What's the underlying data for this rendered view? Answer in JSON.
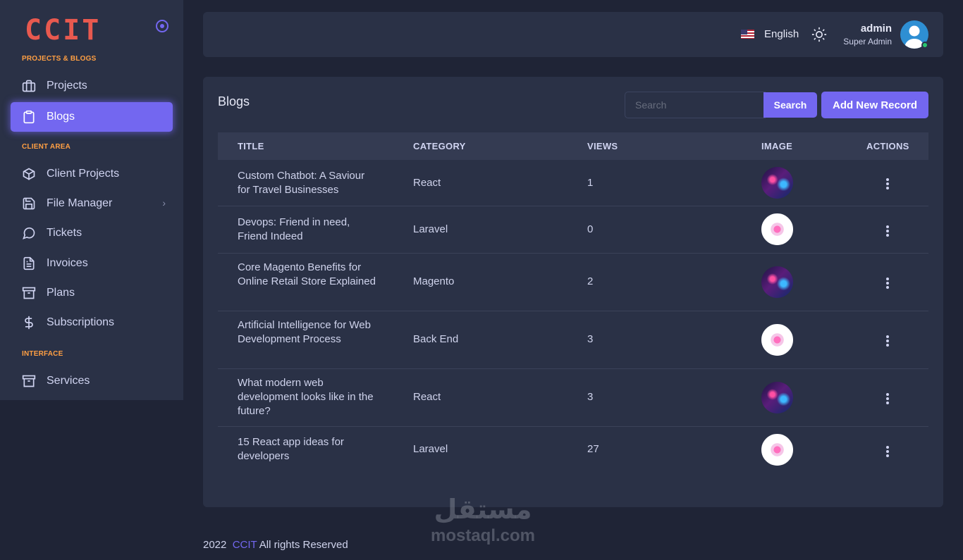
{
  "brand": {
    "logo_text": "CCIT",
    "color": "#e8594f"
  },
  "sidebar": {
    "sections": [
      {
        "label": "PROJECTS & BLOGS"
      },
      {
        "label": "CLIENT AREA"
      },
      {
        "label": "INTERFACE"
      }
    ],
    "items": [
      {
        "label": "Projects",
        "icon": "briefcase-icon"
      },
      {
        "label": "Blogs",
        "icon": "clipboard-icon",
        "active": true
      },
      {
        "label": "Client Projects",
        "icon": "box-icon"
      },
      {
        "label": "File Manager",
        "icon": "save-icon",
        "has_submenu": true
      },
      {
        "label": "Tickets",
        "icon": "message-circle-icon"
      },
      {
        "label": "Invoices",
        "icon": "file-text-icon"
      },
      {
        "label": "Plans",
        "icon": "archive-icon"
      },
      {
        "label": "Subscriptions",
        "icon": "dollar-icon"
      },
      {
        "label": "Services",
        "icon": "archive-icon"
      }
    ]
  },
  "topbar": {
    "language": "English",
    "user": {
      "name": "admin",
      "role": "Super Admin",
      "status": "online"
    }
  },
  "card": {
    "title": "Blogs",
    "search": {
      "placeholder": "Search",
      "button_label": "Search"
    },
    "add_button_label": "Add New Record"
  },
  "table": {
    "columns": [
      "TITLE",
      "CATEGORY",
      "VIEWS",
      "IMAGE",
      "ACTIONS"
    ],
    "rows": [
      {
        "title": "Custom Chatbot: A Saviour for Travel Businesses",
        "category": "React",
        "views": "1",
        "image": "dark"
      },
      {
        "title": "Devops: Friend in need, Friend Indeed",
        "category": "Laravel",
        "views": "0",
        "image": "light"
      },
      {
        "title": "Core Magento Benefits for Online Retail Store Explained",
        "category": "Magento",
        "views": "2",
        "image": "dark"
      },
      {
        "title": "Artificial Intelligence for Web Development Process",
        "category": "Back End",
        "views": "3",
        "image": "light"
      },
      {
        "title": "What modern web development looks like in the future?",
        "category": "React",
        "views": "3",
        "image": "dark"
      },
      {
        "title": "15 React app ideas for developers",
        "category": "Laravel",
        "views": "27",
        "image": "light"
      }
    ]
  },
  "footer": {
    "year": "2022",
    "brand": "CCIT",
    "text": "All rights Reserved"
  },
  "watermark": {
    "arabic": "مستقل",
    "latin": "mostaql.com"
  },
  "colors": {
    "accent": "#7367f0",
    "section_header": "#ff9f43",
    "background": "#1f2436",
    "panel": "#2a3146"
  }
}
